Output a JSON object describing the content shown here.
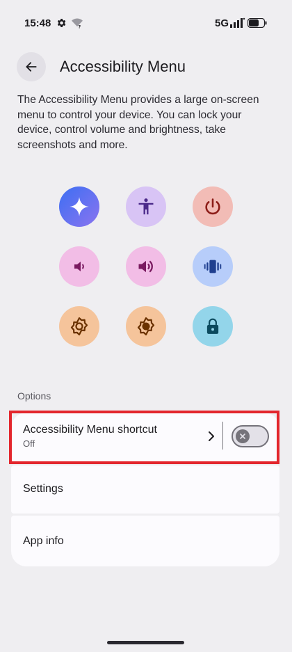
{
  "status_bar": {
    "time": "15:48",
    "network": "5G",
    "icons": [
      "gear-icon",
      "wifi-off-icon",
      "signal-icon",
      "battery-icon"
    ]
  },
  "header": {
    "title": "Accessibility Menu",
    "back_icon": "arrow-back-icon"
  },
  "description": "The Accessibility Menu provides a large on-screen menu to control your device. You can lock your device, control volume and brightness, take screenshots and more.",
  "features": [
    {
      "icon": "assistant-sparkle-icon",
      "color": "#5a7df0"
    },
    {
      "icon": "accessibility-person-icon",
      "color": "#d8c4f5"
    },
    {
      "icon": "power-icon",
      "color": "#f2bcb6"
    },
    {
      "icon": "volume-down-icon",
      "color": "#f2bde6"
    },
    {
      "icon": "volume-up-icon",
      "color": "#f2bde6"
    },
    {
      "icon": "vibrate-icon",
      "color": "#b7cdfa"
    },
    {
      "icon": "brightness-low-icon",
      "color": "#f5c49b"
    },
    {
      "icon": "brightness-high-icon",
      "color": "#f5c49b"
    },
    {
      "icon": "lock-icon",
      "color": "#93d5ea"
    }
  ],
  "options": {
    "section_label": "Options",
    "shortcut": {
      "title": "Accessibility Menu shortcut",
      "subtitle": "Off",
      "toggle_on": false
    },
    "settings_label": "Settings",
    "app_info_label": "App info"
  },
  "colors": {
    "highlight": "#e3262d",
    "background": "#efeef1",
    "card": "#fcfbfe"
  }
}
